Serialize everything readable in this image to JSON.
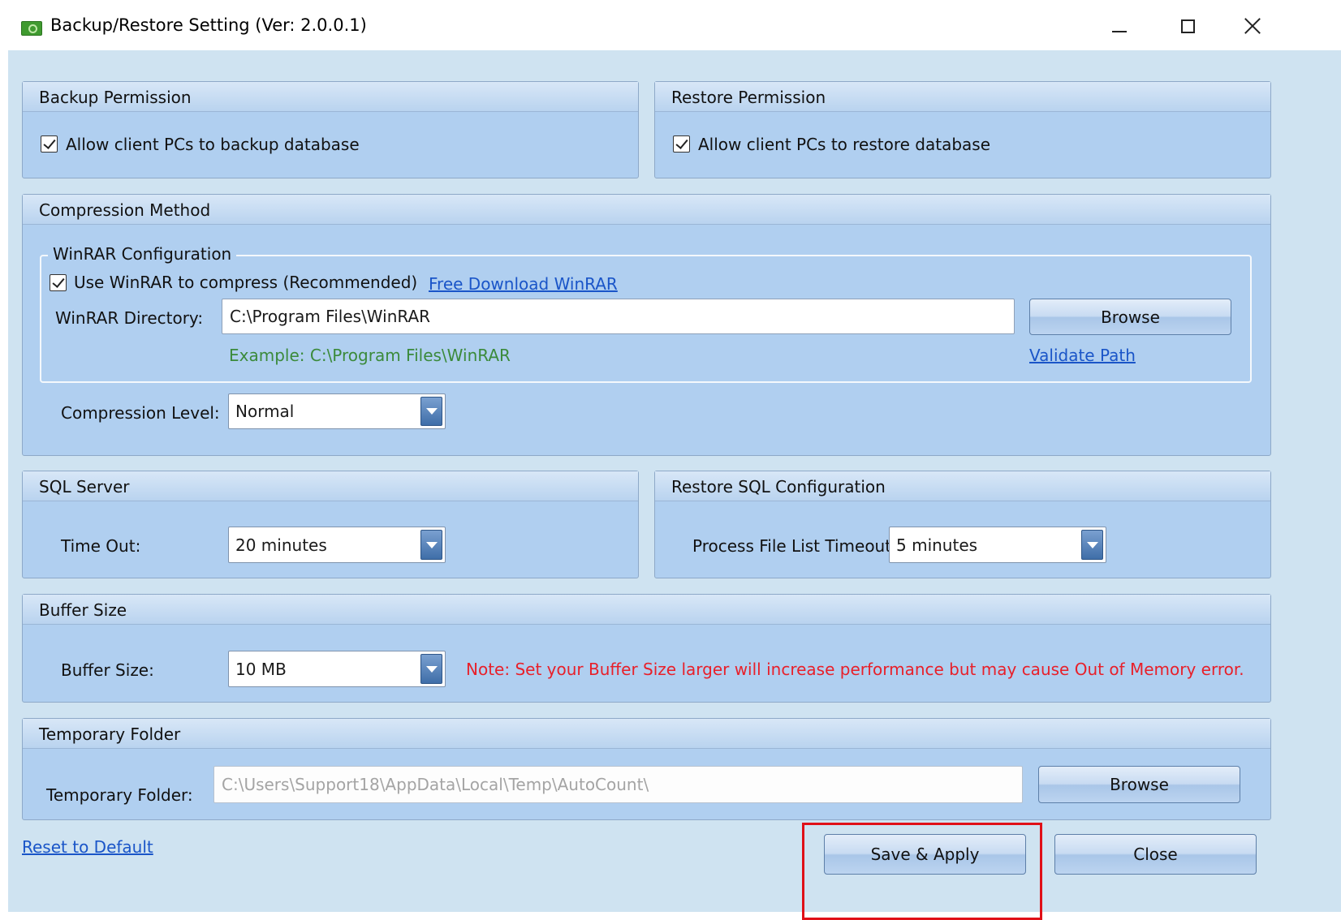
{
  "window": {
    "title": "Backup/Restore Setting (Ver: 2.0.0.1)"
  },
  "backup_permission": {
    "header": "Backup Permission",
    "checkbox_label": "Allow client PCs to backup database",
    "checked": true
  },
  "restore_permission": {
    "header": "Restore Permission",
    "checkbox_label": "Allow client PCs to restore database",
    "checked": true
  },
  "compression": {
    "header": "Compression Method",
    "winrar_legend": "WinRAR Configuration",
    "use_winrar_label": "Use WinRAR to compress (Recommended)",
    "use_winrar_checked": true,
    "free_download_link": "Free Download WinRAR",
    "directory_label": "WinRAR Directory:",
    "directory_value": "C:\\Program Files\\WinRAR",
    "browse_label": "Browse",
    "example_text": "Example: C:\\Program Files\\WinRAR",
    "validate_link": "Validate Path",
    "level_label": "Compression Level:",
    "level_value": "Normal"
  },
  "sql_server": {
    "header": "SQL Server",
    "timeout_label": "Time Out:",
    "timeout_value": "20 minutes"
  },
  "restore_sql": {
    "header": "Restore SQL Configuration",
    "process_label": "Process File List Timeout",
    "process_value": "5 minutes"
  },
  "buffer": {
    "header": "Buffer Size",
    "label": "Buffer Size:",
    "value": "10 MB",
    "note": "Note: Set your Buffer Size larger will increase performance but may cause Out of Memory error."
  },
  "temp_folder": {
    "header": "Temporary Folder",
    "label": "Temporary Folder:",
    "value": "C:\\Users\\Support18\\AppData\\Local\\Temp\\AutoCount\\",
    "browse_label": "Browse"
  },
  "footer": {
    "reset_link": "Reset to Default",
    "save_label": "Save & Apply",
    "close_label": "Close"
  },
  "colors": {
    "client_bg": "#cfe3f1",
    "group_bg": "#b0cff0",
    "link": "#1a55c8",
    "example_green": "#3b8a3b",
    "note_red": "#e8202a",
    "highlight_red": "#e01018"
  }
}
